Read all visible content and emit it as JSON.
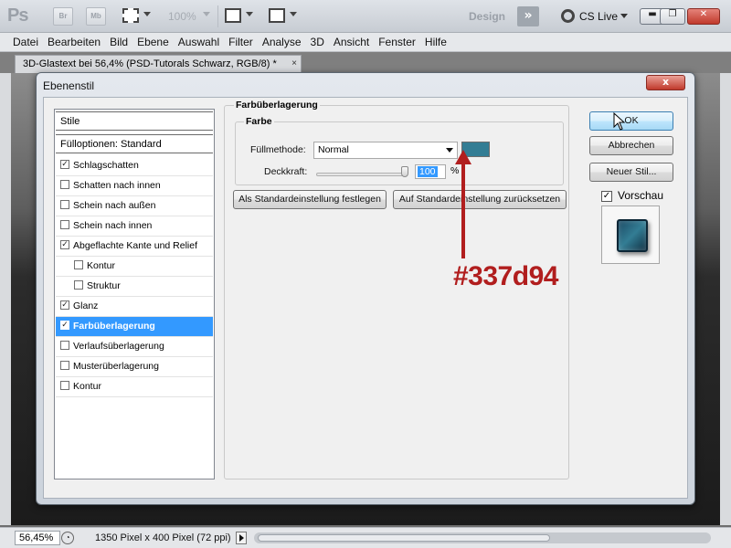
{
  "app": {
    "logo": "Ps",
    "bridge_label": "Br",
    "minibridge_label": "Mb",
    "zoom": "100%",
    "workspace": "Design",
    "expand_glyph": "»",
    "cs_live": "CS Live"
  },
  "menu": [
    "Datei",
    "Bearbeiten",
    "Bild",
    "Ebene",
    "Auswahl",
    "Filter",
    "Analyse",
    "3D",
    "Ansicht",
    "Fenster",
    "Hilfe"
  ],
  "document_tab": {
    "title": "3D-Glastext bei 56,4% (PSD-Tutorals Schwarz, RGB/8) *",
    "close": "×"
  },
  "status": {
    "zoom": "56,45%",
    "doc_info": "1350 Pixel x 400 Pixel (72 ppi)"
  },
  "dialog": {
    "title": "Ebenenstil",
    "close": "x",
    "style_list": {
      "header": "Stile",
      "fill_options": "Fülloptionen: Standard",
      "items": [
        {
          "label": "Schlagschatten",
          "checked": true,
          "indent": false,
          "selected": false
        },
        {
          "label": "Schatten nach innen",
          "checked": false,
          "indent": false,
          "selected": false
        },
        {
          "label": "Schein nach außen",
          "checked": false,
          "indent": false,
          "selected": false
        },
        {
          "label": "Schein nach innen",
          "checked": false,
          "indent": false,
          "selected": false
        },
        {
          "label": "Abgeflachte Kante und Relief",
          "checked": true,
          "indent": false,
          "selected": false
        },
        {
          "label": "Kontur",
          "checked": false,
          "indent": true,
          "selected": false
        },
        {
          "label": "Struktur",
          "checked": false,
          "indent": true,
          "selected": false
        },
        {
          "label": "Glanz",
          "checked": true,
          "indent": false,
          "selected": false
        },
        {
          "label": "Farbüberlagerung",
          "checked": true,
          "indent": false,
          "selected": true
        },
        {
          "label": "Verlaufsüberlagerung",
          "checked": false,
          "indent": false,
          "selected": false
        },
        {
          "label": "Musterüberlagerung",
          "checked": false,
          "indent": false,
          "selected": false
        },
        {
          "label": "Kontur",
          "checked": false,
          "indent": false,
          "selected": false
        }
      ]
    },
    "panel": {
      "title": "Farbüberlagerung",
      "group": "Farbe",
      "blend_mode_label": "Füllmethode:",
      "blend_mode_value": "Normal",
      "overlay_color": "#337d94",
      "opacity_label": "Deckkraft:",
      "opacity_value": "100",
      "opacity_unit": "%",
      "opacity_level": 1.0,
      "set_default_button": "Als Standardeinstellung festlegen",
      "reset_default_button": "Auf Standardeinstellung zurücksetzen"
    },
    "buttons": {
      "ok": "OK",
      "cancel": "Abbrechen",
      "new_style": "Neuer Stil...",
      "preview_label": "Vorschau",
      "preview_checked": true
    }
  },
  "annotation": {
    "text": "#337d94",
    "color": "#b11e1e"
  },
  "check_glyph": "✓"
}
